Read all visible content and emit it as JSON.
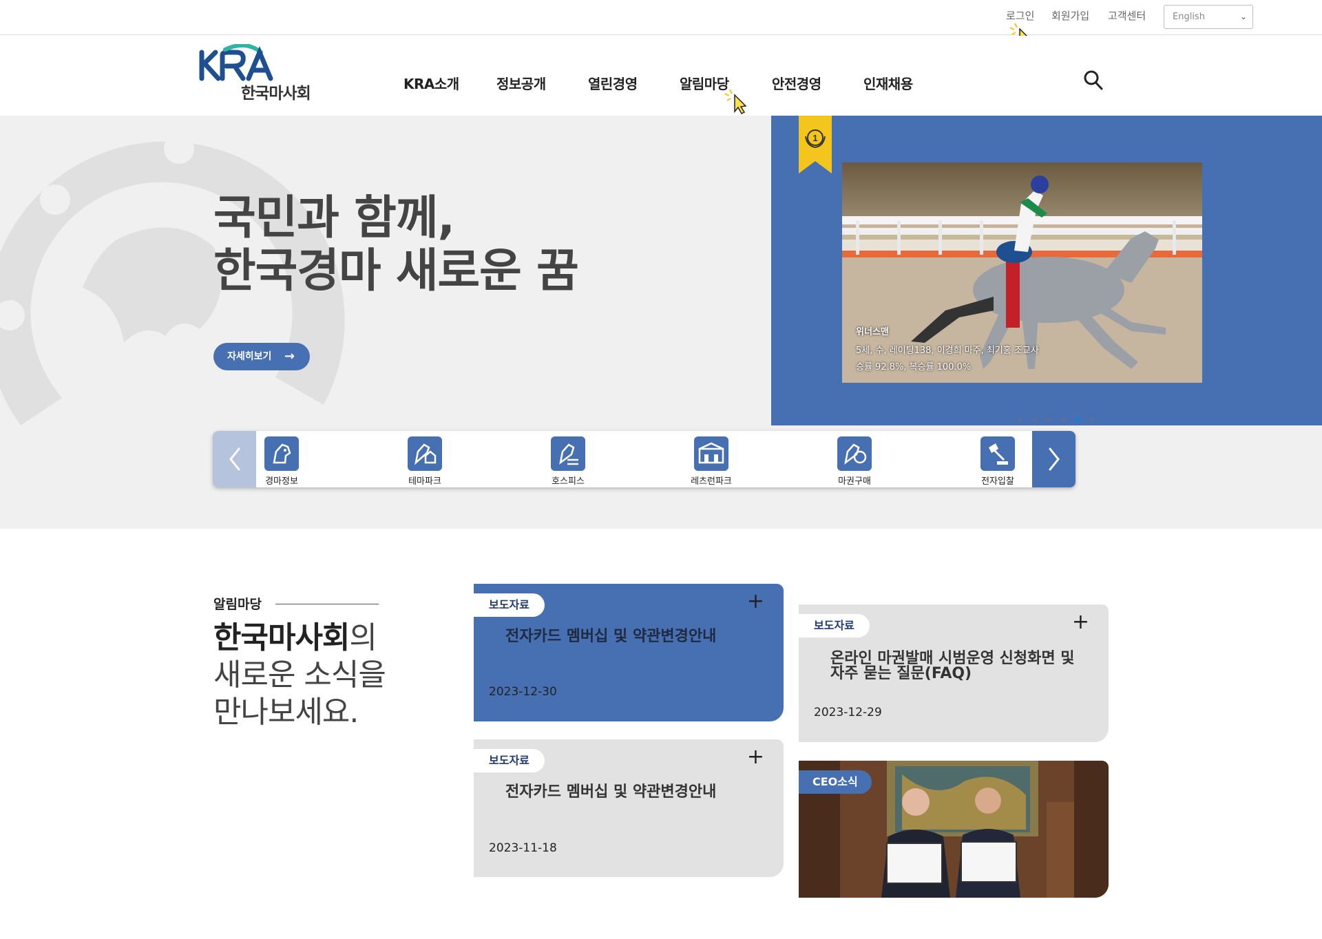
{
  "util": {
    "login": "로그인",
    "join": "회원가입",
    "customer": "고객센터",
    "language": "English"
  },
  "brand": {
    "name": "한국마사회",
    "wordmark": "KRA"
  },
  "gnb": [
    "KRA소개",
    "정보공개",
    "열린경영",
    "알림마당",
    "안전경영",
    "인재채용"
  ],
  "hero": {
    "title_line1": "국민과 함께,",
    "title_line2": "한국경마 새로운 꿈",
    "button": "자세히보기",
    "slide": {
      "horse": "위너스맨",
      "info1": "5세, 수, 레이팅138, 이경희 마주, 최기홍 조교사",
      "info2": "승률 92.8%, 복승률 100.0%",
      "slides": 6,
      "active_slide": 5
    }
  },
  "quick_links": [
    "경마정보",
    "테마파크",
    "호스피스",
    "레츠런파크",
    "마권구매",
    "전자입찰"
  ],
  "notice": {
    "kicker": "알림마당",
    "title_strong": "한국마사회",
    "title_rest1": "의",
    "title_rest2": "새로운 소식을",
    "title_rest3": "만나보세요.",
    "cards": [
      {
        "category": "보도자료",
        "title": "전자카드 멤버십 및 약관변경안내",
        "date": "2023-12-30"
      },
      {
        "category": "보도자료",
        "title": "전자카드 멤버십 및 약관변경안내",
        "date": "2023-11-18"
      },
      {
        "category": "보도자료",
        "title": "온라인 마권발매 시범운영 신청화면 및 자주 묻는 질문(FAQ)",
        "date": "2023-12-29"
      }
    ],
    "ceo_badge": "CEO소식"
  },
  "colors": {
    "brand_blue": "#4670b1",
    "hero_bg": "#f0f0f0",
    "card_grey": "#e2e2e2",
    "badge_yellow": "#f4c51c"
  }
}
